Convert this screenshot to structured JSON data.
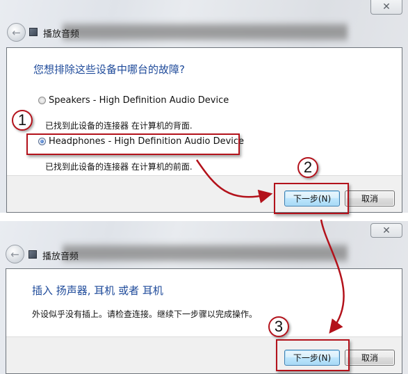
{
  "dialogs": [
    {
      "title": "播放音频",
      "close_icon": "close-icon",
      "back_icon": "back-arrow-icon",
      "heading": "您想排除这些设备中哪台的故障?",
      "options": [
        {
          "label": "Speakers - High Definition Audio Device",
          "description": "已找到此设备的连接器 在计算机的背面.",
          "selected": false
        },
        {
          "label": "Headphones - High Definition Audio Device",
          "description": "已找到此设备的连接器 在计算机的前面.",
          "selected": true
        }
      ],
      "buttons": {
        "next": "下一步(N)",
        "cancel": "取消"
      }
    },
    {
      "title": "播放音频",
      "close_icon": "close-icon",
      "back_icon": "back-arrow-icon",
      "heading": "插入 扬声器, 耳机 或者 耳机",
      "message": "外设似乎没有插上。请检查连接。继续下一步骤以完成操作。",
      "buttons": {
        "next": "下一步(N)",
        "cancel": "取消"
      }
    }
  ],
  "annotations": {
    "steps": [
      "1",
      "2",
      "3"
    ],
    "highlight_color": "#b3121b",
    "accent_heading_color": "#1e4a9a"
  },
  "icons": {
    "close": "✕",
    "back": "←"
  }
}
